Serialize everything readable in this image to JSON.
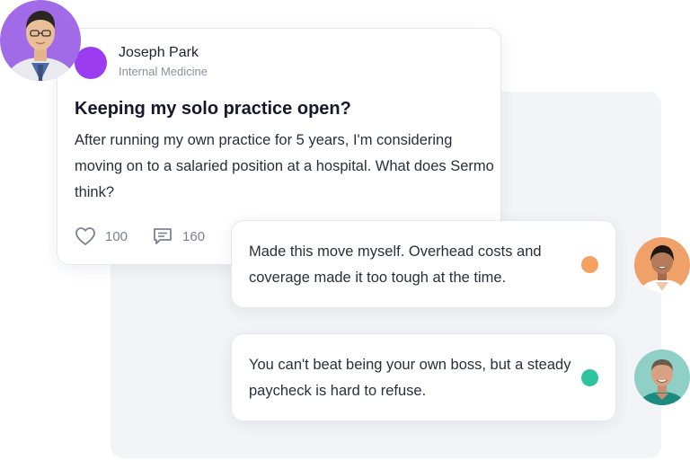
{
  "post": {
    "author_name": "Joseph Park",
    "author_specialty": "Internal Medicine",
    "title": "Keeping my solo practice open?",
    "body": "After running my own practice for 5 years, I'm considering moving on to a salaried position at a hospital. What does Sermo think?",
    "likes": "100",
    "comments": "160",
    "author_color": "#9b3cf0"
  },
  "replies": [
    {
      "text": "Made this move myself. Overhead costs and coverage made it too tough at the time.",
      "status_color": "#f4a15f"
    },
    {
      "text": "You can't beat being your own boss, but a steady paycheck is hard to refuse.",
      "status_color": "#2ec4a0"
    }
  ],
  "icons": {
    "like": "heart-icon",
    "comment": "comment-icon"
  }
}
